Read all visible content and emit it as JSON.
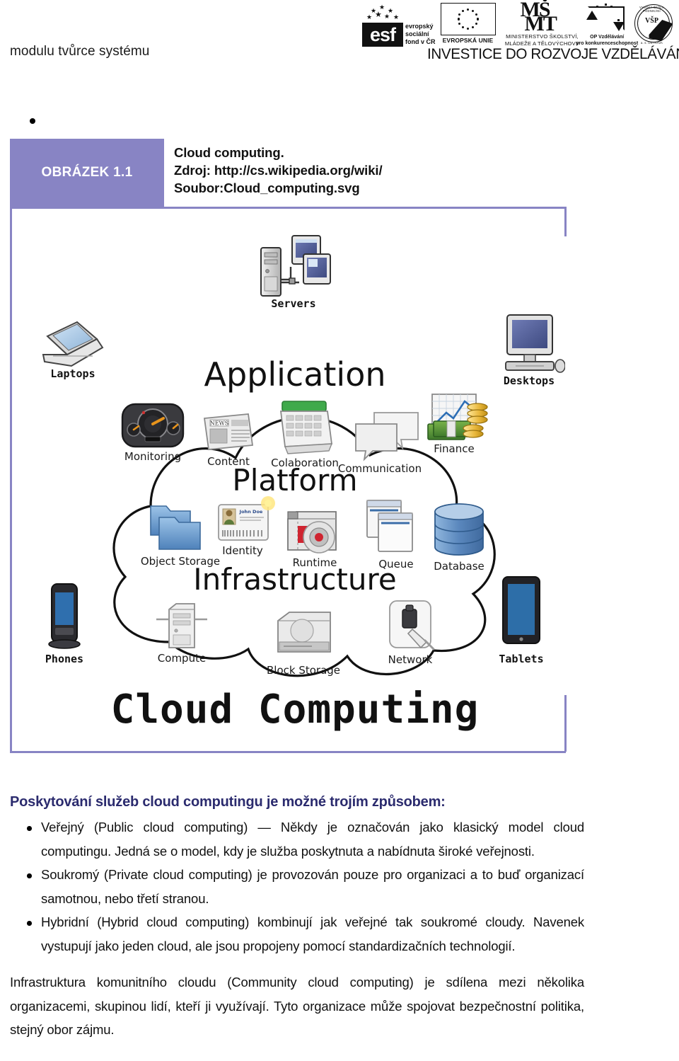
{
  "header": {
    "running_title": "modulu tvůrce systému",
    "slogan": "INVESTICE DO ROZVOJE VZDĚLÁVÁNÍ",
    "logos": [
      {
        "name": "esf-logo",
        "mark": "esf",
        "caption_lines": [
          "evropský",
          "sociální",
          "fond v ČR"
        ]
      },
      {
        "name": "eu-logo",
        "caption": "EVROPSKÁ UNIE"
      },
      {
        "name": "msmt-logo",
        "mark_line1": "MŠ",
        "mark_line2": "MT",
        "caption_lines": [
          "MINISTERSTVO ŠKOLSTVÍ,",
          "MLÁDEŽE A TĚLOVÝCHOVY"
        ]
      },
      {
        "name": "op-vzdelavani-logo",
        "caption_lines": [
          "OP Vzdělávání",
          "pro konkurenceschopnost"
        ]
      },
      {
        "name": "vsp-logo",
        "mark": "VŠP",
        "ring_top": "VYSOKÁ ŠKOLA PODNIKÁNÍ",
        "ring_bottom": "a. s. OSTRAVA"
      }
    ]
  },
  "figure": {
    "badge_label": "OBRÁZEK 1.1",
    "caption_lines": [
      "Cloud computing.",
      "Zdroj: http://cs.wikipedia.org/wiki/",
      "Soubor:Cloud_computing.svg"
    ],
    "accent_color": "#8884c4",
    "diagram": {
      "title": "Cloud Computing",
      "layers": [
        "Application",
        "Platform",
        "Infrastructure"
      ],
      "external_nodes": [
        {
          "label": "Servers",
          "icon": "servers-icon"
        },
        {
          "label": "Laptops",
          "icon": "laptop-icon"
        },
        {
          "label": "Desktops",
          "icon": "desktop-icon"
        },
        {
          "label": "Phones",
          "icon": "phone-icon"
        },
        {
          "label": "Tablets",
          "icon": "tablet-icon"
        }
      ],
      "application_nodes": [
        {
          "label": "Monitoring",
          "icon": "gauge-icon"
        },
        {
          "label": "Content",
          "icon": "newspaper-icon"
        },
        {
          "label": "Colaboration",
          "icon": "calendar-icon"
        },
        {
          "label": "Communication",
          "icon": "chat-bubbles-icon"
        },
        {
          "label": "Finance",
          "icon": "money-chart-icon"
        }
      ],
      "platform_nodes": [
        {
          "label": "Object Storage",
          "icon": "folders-icon"
        },
        {
          "label": "Identity",
          "icon": "id-card-icon"
        },
        {
          "label": "Runtime",
          "icon": "runtime-disc-icon"
        },
        {
          "label": "Queue",
          "icon": "windows-queue-icon"
        },
        {
          "label": "Database",
          "icon": "database-cylinder-icon"
        }
      ],
      "infrastructure_nodes": [
        {
          "label": "Compute",
          "icon": "compute-server-icon"
        },
        {
          "label": "Block Storage",
          "icon": "hard-drive-icon"
        },
        {
          "label": "Network",
          "icon": "network-plug-icon"
        }
      ]
    }
  },
  "body": {
    "heading": "Poskytování služeb cloud computingu je možné trojím způsobem:",
    "bullets": [
      "Veřejný (Public cloud computing) — Někdy je označován jako klasický model cloud computingu. Jedná se o model, kdy je služba poskytnuta a nabídnuta široké veřejnosti.",
      "Soukromý (Private cloud computing) je provozován pouze pro organizaci a to buď organizací samotnou, nebo třetí stranou.",
      "Hybridní (Hybrid cloud computing) kombinují jak veřejné tak soukromé cloudy. Navenek vystupují jako jeden cloud, ale jsou propojeny pomocí standardizačních technologií."
    ],
    "closing_paragraph": "Infrastruktura komunitního cloudu (Community cloud computing) je sdílena mezi několika organizacemi, skupinou lidí, kteří ji využívají. Tyto organizace může spojovat bezpečnostní politika, stejný obor zájmu.",
    "heading_color": "#2b2b6e"
  }
}
